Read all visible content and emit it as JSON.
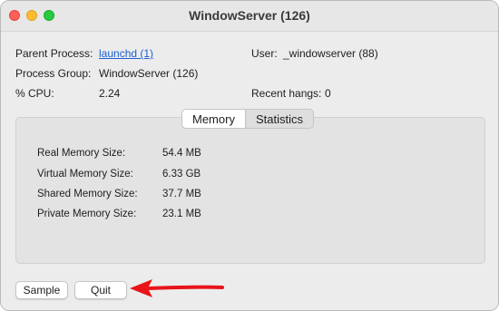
{
  "window": {
    "title": "WindowServer (126)"
  },
  "info": {
    "parent_process_label": "Parent Process:",
    "parent_process_value": "launchd (1)",
    "process_group_label": "Process Group:",
    "process_group_value": "WindowServer (126)",
    "cpu_label": "% CPU:",
    "cpu_value": "2.24",
    "user_label": "User:",
    "user_value": "_windowserver (88)",
    "recent_hangs_label": "Recent hangs:",
    "recent_hangs_value": "0"
  },
  "tabs": [
    {
      "label": "Memory",
      "selected": true
    },
    {
      "label": "Statistics",
      "selected": false
    }
  ],
  "memory": {
    "rows": [
      {
        "label": "Real Memory Size:",
        "value": "54.4 MB"
      },
      {
        "label": "Virtual Memory Size:",
        "value": "6.33 GB"
      },
      {
        "label": "Shared Memory Size:",
        "value": "37.7 MB"
      },
      {
        "label": "Private Memory Size:",
        "value": "23.1 MB"
      }
    ]
  },
  "buttons": {
    "sample_label": "Sample",
    "quit_label": "Quit"
  },
  "colors": {
    "annotation_arrow": "#e8141a",
    "link": "#1f5fd1"
  },
  "icons": {
    "close": "close-button-icon",
    "minimize": "minimize-button-icon",
    "maximize": "maximize-button-icon",
    "annotation": "red-arrow-icon"
  }
}
